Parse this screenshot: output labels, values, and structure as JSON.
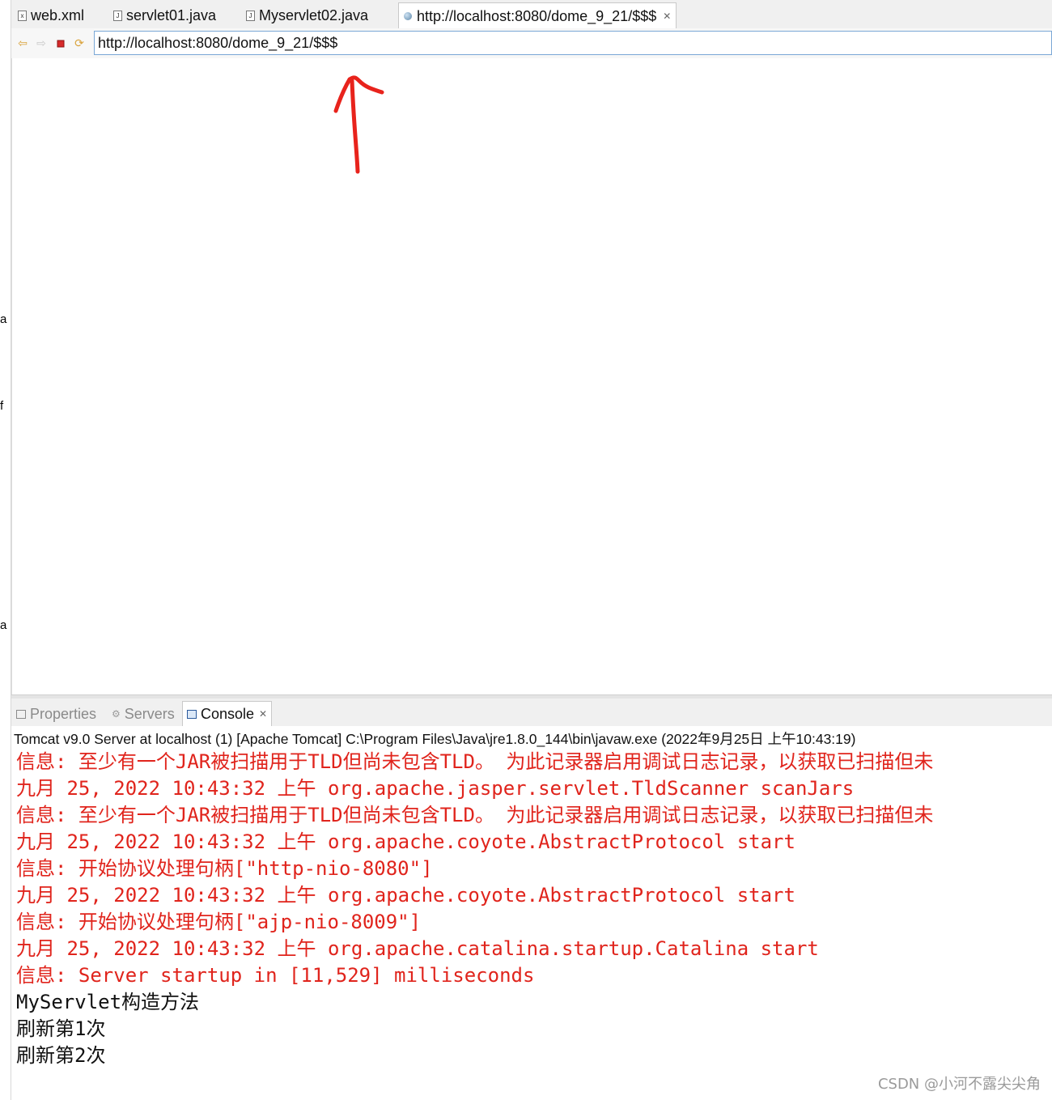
{
  "editor_tabs": [
    {
      "label": "web.xml",
      "icon": "xml-file-icon"
    },
    {
      "label": "servlet01.java",
      "icon": "java-file-icon"
    },
    {
      "label": "Myservlet02.java",
      "icon": "java-file-icon"
    },
    {
      "label": "http://localhost:8080/dome_9_21/$$$",
      "icon": "globe-icon",
      "active": true
    }
  ],
  "gutter_letters": [
    "a",
    "f",
    "a"
  ],
  "url_bar": {
    "value": "http://localhost:8080/dome_9_21/$$$"
  },
  "nav_buttons": [
    "back-icon",
    "forward-icon",
    "stop-icon",
    "refresh-icon"
  ],
  "annotation": {
    "type": "red-arrow",
    "color": "#e8231c"
  },
  "view_tabs": [
    {
      "label": "Properties",
      "active": false
    },
    {
      "label": "Servers",
      "active": false
    },
    {
      "label": "Console",
      "active": true
    }
  ],
  "console": {
    "header": "Tomcat v9.0 Server at localhost (1) [Apache Tomcat] C:\\Program Files\\Java\\jre1.8.0_144\\bin\\javaw.exe (2022年9月25日 上午10:43:19)",
    "lines": [
      {
        "text": "信息: 至少有一个JAR被扫描用于TLD但尚未包含TLD。 为此记录器启用调试日志记录，以获取已扫描但未",
        "type": "err"
      },
      {
        "text": "九月 25, 2022 10:43:32 上午 org.apache.jasper.servlet.TldScanner scanJars",
        "type": "err"
      },
      {
        "text": "信息: 至少有一个JAR被扫描用于TLD但尚未包含TLD。 为此记录器启用调试日志记录，以获取已扫描但未",
        "type": "err"
      },
      {
        "text": "九月 25, 2022 10:43:32 上午 org.apache.coyote.AbstractProtocol start",
        "type": "err"
      },
      {
        "text": "信息: 开始协议处理句柄[\"http-nio-8080\"]",
        "type": "err"
      },
      {
        "text": "九月 25, 2022 10:43:32 上午 org.apache.coyote.AbstractProtocol start",
        "type": "err"
      },
      {
        "text": "信息: 开始协议处理句柄[\"ajp-nio-8009\"]",
        "type": "err"
      },
      {
        "text": "九月 25, 2022 10:43:32 上午 org.apache.catalina.startup.Catalina start",
        "type": "err"
      },
      {
        "text": "信息: Server startup in [11,529] milliseconds",
        "type": "err"
      },
      {
        "text": "MyServlet构造方法",
        "type": "out"
      },
      {
        "text": "刷新第1次",
        "type": "out"
      },
      {
        "text": "刷新第2次",
        "type": "out"
      }
    ]
  },
  "colors": {
    "error_text": "#e0241c",
    "normal_text": "#111111",
    "url_border": "#7aa7d6"
  },
  "watermark": "CSDN @小河不露尖尖角"
}
